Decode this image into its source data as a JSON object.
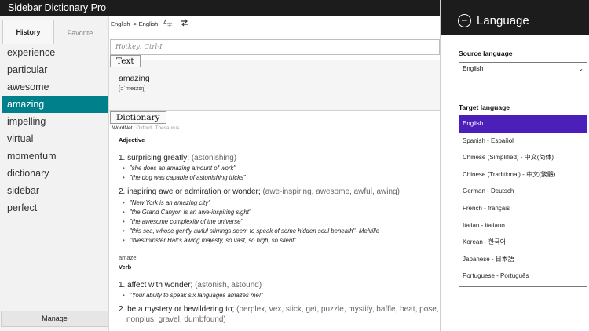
{
  "app": {
    "title": "Sidebar Dictionary Pro"
  },
  "sidebar": {
    "tabs": {
      "history": "History",
      "favorite": "Favorite"
    },
    "words": [
      "experience",
      "particular",
      "awesome",
      "amazing",
      "impelling",
      "virtual",
      "momentum",
      "dictionary",
      "sidebar",
      "perfect"
    ],
    "selected_word": "amazing",
    "manage_label": "Manage"
  },
  "main": {
    "toolbar": {
      "lang_pair": "English -> English",
      "translate_icon": "translate-icon",
      "swap_icon": "swap-icon"
    },
    "hotkey_placeholder": "Hotkey: Ctrl-I",
    "text_section": {
      "label": "Text",
      "word": "amazing",
      "phonetic": "[əˈmeɪzɪŋ]"
    },
    "dict_section": {
      "label": "Dictionary",
      "sources": [
        "WordNet",
        "Oxford",
        "Thesaurus"
      ],
      "active_source": "WordNet",
      "adjective": {
        "pos": "Adjective",
        "def1": {
          "text": "1. surprising greatly; ",
          "syn": "(astonishing)"
        },
        "def1_examples": [
          "\"she does an amazing amount of work\"",
          "\"the dog was capable of astonishing tricks\""
        ],
        "def2": {
          "text": "2. inspiring awe or admiration or wonder; ",
          "syn": "(awe-inspiring, awesome, awful, awing)"
        },
        "def2_examples": [
          "\"New York is an amazing city\"",
          "\"the Grand Canyon is an awe-inspiring sight\"",
          "\"the awesome complexity of the universe\"",
          "\"this sea, whose gently awful stirrings seem to speak of some hidden soul beneath\"- Melville",
          "\"Westminster Hall's awing majesty, so vast, so high, so silent\""
        ]
      },
      "verb": {
        "headword": "amaze",
        "pos": "Verb",
        "def1": {
          "text": "1. affect with wonder; ",
          "syn": "(astonish, astound)"
        },
        "def1_examples": [
          "\"Your ability to speak six languages amazes me!\""
        ],
        "def2": {
          "text": "2. be a mystery or bewildering to; ",
          "syn": "(perplex, vex, stick, get, puzzle, mystify, baffle, beat, pose,"
        },
        "def2_cont": "nonplus, gravel, dumbfound)"
      }
    }
  },
  "panel": {
    "title": "Language",
    "back_icon": "back-arrow-icon",
    "source_label": "Source language",
    "source_value": "English",
    "target_label": "Target language",
    "target_options": [
      "English",
      "Spanish - Español",
      "Chinese (Simplified) - 中文(简体)",
      "Chinese (Traditional) - 中文(繁體)",
      "German - Deutsch",
      "French - français",
      "Italian - italiano",
      "Korean - 한국어",
      "Japanese - 日本語",
      "Portuguese - Português"
    ],
    "target_selected": "English",
    "accent_color": "#4b1fb8"
  },
  "colors": {
    "selection": "#00808a",
    "titlebar": "#1c1c1c"
  }
}
